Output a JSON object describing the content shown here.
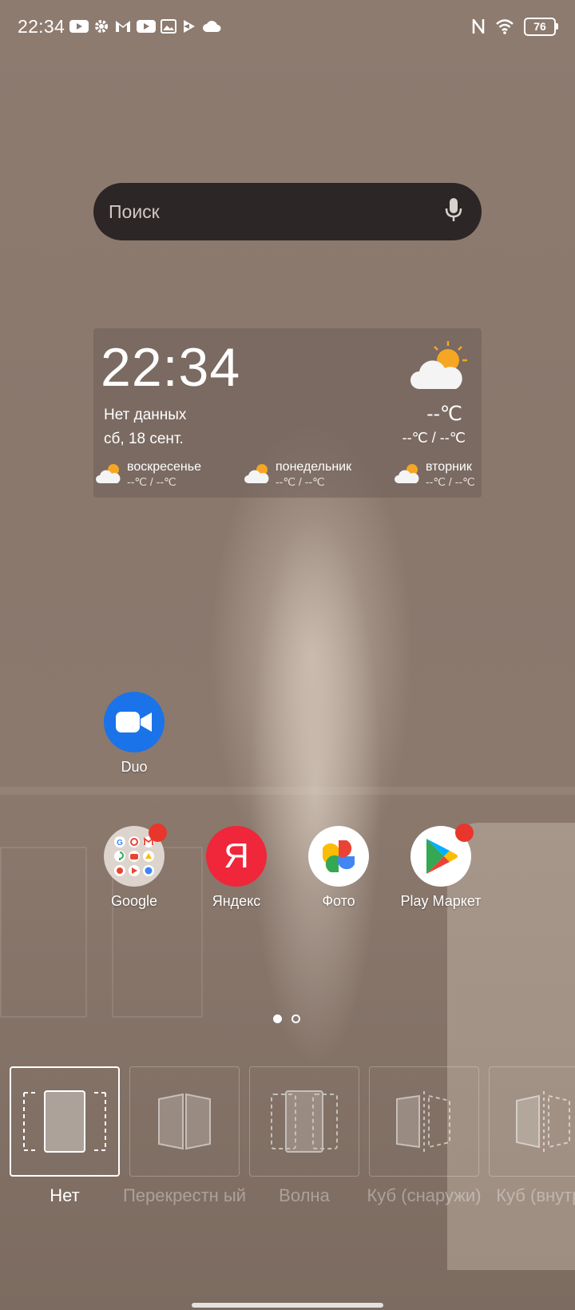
{
  "status_bar": {
    "time": "22:34",
    "notification_icons": [
      "youtube-icon",
      "settings-gear-icon",
      "gmail-icon",
      "youtube-icon",
      "gallery-icon",
      "play-store-icon",
      "cloud-icon"
    ],
    "nfc_icon": "nfc-icon",
    "wifi_icon": "wifi-icon",
    "battery_level": "76"
  },
  "search": {
    "placeholder": "Поиск",
    "mic_icon": "microphone-icon"
  },
  "weather_widget": {
    "time": "22:34",
    "status": "Нет данных",
    "date": "сб, 18 сент.",
    "current_temp": "--℃",
    "range": "--℃ / --℃",
    "forecast": [
      {
        "day": "воскресенье",
        "range": "--℃ / --℃"
      },
      {
        "day": "понедельник",
        "range": "--℃ / --℃"
      },
      {
        "day": "вторник",
        "range": "--℃ / --℃"
      }
    ]
  },
  "apps": {
    "duo": {
      "label": "Duo",
      "color": "#1a73e8"
    },
    "google": {
      "label": "Google",
      "badge": true
    },
    "yandex": {
      "label": "Яндекс",
      "glyph": "Я",
      "color": "#f0263a"
    },
    "photos": {
      "label": "Фото"
    },
    "play": {
      "label": "Play Маркет",
      "badge": true
    }
  },
  "page_indicator": {
    "pages": 2,
    "current": 1
  },
  "transition_effects": [
    {
      "label": "Нет",
      "selected": true
    },
    {
      "label": "Перекрестн ый",
      "selected": false
    },
    {
      "label": "Волна",
      "selected": false
    },
    {
      "label": "Куб (снаружи)",
      "selected": false
    },
    {
      "label": "Куб (внутри",
      "selected": false
    }
  ]
}
